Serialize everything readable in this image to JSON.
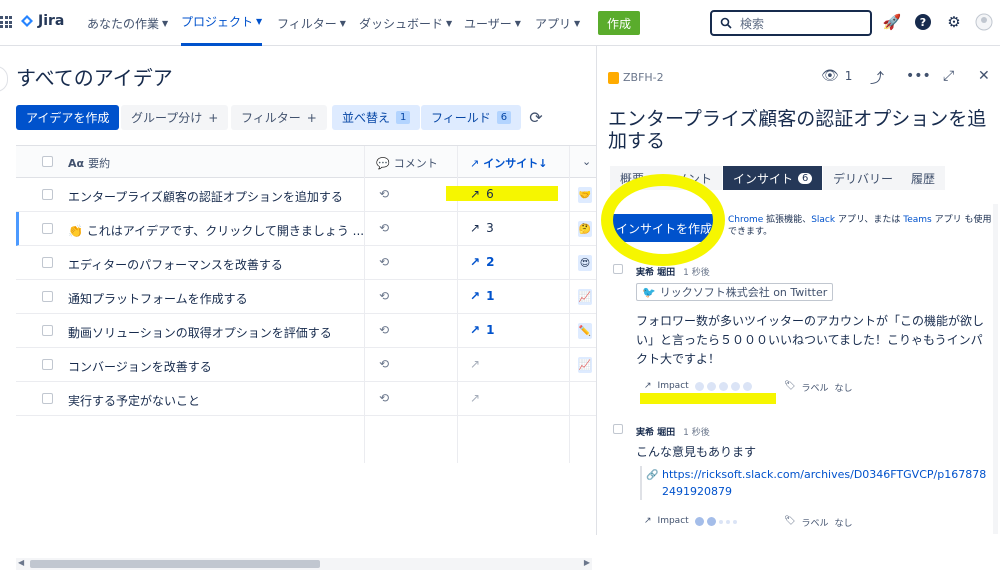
{
  "topbar": {
    "logo": "Jira",
    "nav": [
      {
        "label": "あなたの作業"
      },
      {
        "label": "プロジェクト"
      },
      {
        "label": "フィルター"
      },
      {
        "label": "ダッシュボード"
      },
      {
        "label": "ユーザー"
      },
      {
        "label": "アプリ"
      }
    ],
    "create": "作成",
    "search_placeholder": "検索"
  },
  "list": {
    "title": "すべてのアイデア",
    "toolbar": {
      "create": "アイデアを作成",
      "group": "グループ分け",
      "filter": "フィルター",
      "sort": "並べ替え",
      "sort_count": "1",
      "fields": "フィールド",
      "fields_count": "6",
      "plus": "+"
    },
    "columns": {
      "summary": "要約",
      "summary_prefix": "Aα",
      "comments": "コメント",
      "insights": "インサイト↓"
    },
    "rows": [
      {
        "title": "エンタープライズ顧客の認証オプションを追加する",
        "insights": "6",
        "emoji": "🤝"
      },
      {
        "title": "これはアイデアです、クリックして開きましょう ...",
        "insights": "3",
        "emoji": "🤔"
      },
      {
        "title": "エディターのパフォーマンスを改善する",
        "insights": "2",
        "emoji": "😍"
      },
      {
        "title": "通知プラットフォームを作成する",
        "insights": "1",
        "emoji": "📈"
      },
      {
        "title": "動画ソリューションの取得オプションを評価する",
        "insights": "1",
        "emoji": "✏️"
      },
      {
        "title": "コンバージョンを改善する",
        "insights": "",
        "emoji": "📈"
      },
      {
        "title": "実行する予定がないこと",
        "insights": "",
        "emoji": ""
      }
    ],
    "row_emoji_prefix": "👏"
  },
  "detail": {
    "key": "ZBFH-2",
    "watchers": "1",
    "title": "エンタープライズ顧客の認証オプションを追加する",
    "tabs": [
      {
        "label": "概要"
      },
      {
        "label": "コメント"
      },
      {
        "label": "インサイト",
        "count": "6"
      },
      {
        "label": "デリバリー"
      },
      {
        "label": "履歴"
      }
    ],
    "create_insight": "インサイトを作成",
    "hint": {
      "a": "Chrome",
      "b": " 拡張機能、",
      "c": "Slack",
      "d": " アプリ、または ",
      "e": "Teams",
      "f": " アプリ も使用できます。"
    },
    "insights": [
      {
        "author": "実希 堀田",
        "time": "1 秒後",
        "source": "リックソフト株式会社 on Twitter",
        "body": "フォロワー数が多いツイッターのアカウントが「この機能が欲しい」と言ったら５０００いいねついてました！こりゃもうインパクト大ですよ！",
        "impact_label": "Impact",
        "labels_label": "ラベル",
        "labels_value": "なし"
      },
      {
        "author": "実希 堀田",
        "time": "1 秒後",
        "body": "こんな意見もあります",
        "link": "https://ricksoft.slack.com/archives/D0346FTGVCP/p1678782491920879",
        "impact_label": "Impact",
        "labels_label": "ラベル",
        "labels_value": "なし"
      }
    ]
  },
  "colors": {
    "brand": "#0052cc",
    "create": "#5aac2c",
    "highlight": "#f6f600"
  }
}
